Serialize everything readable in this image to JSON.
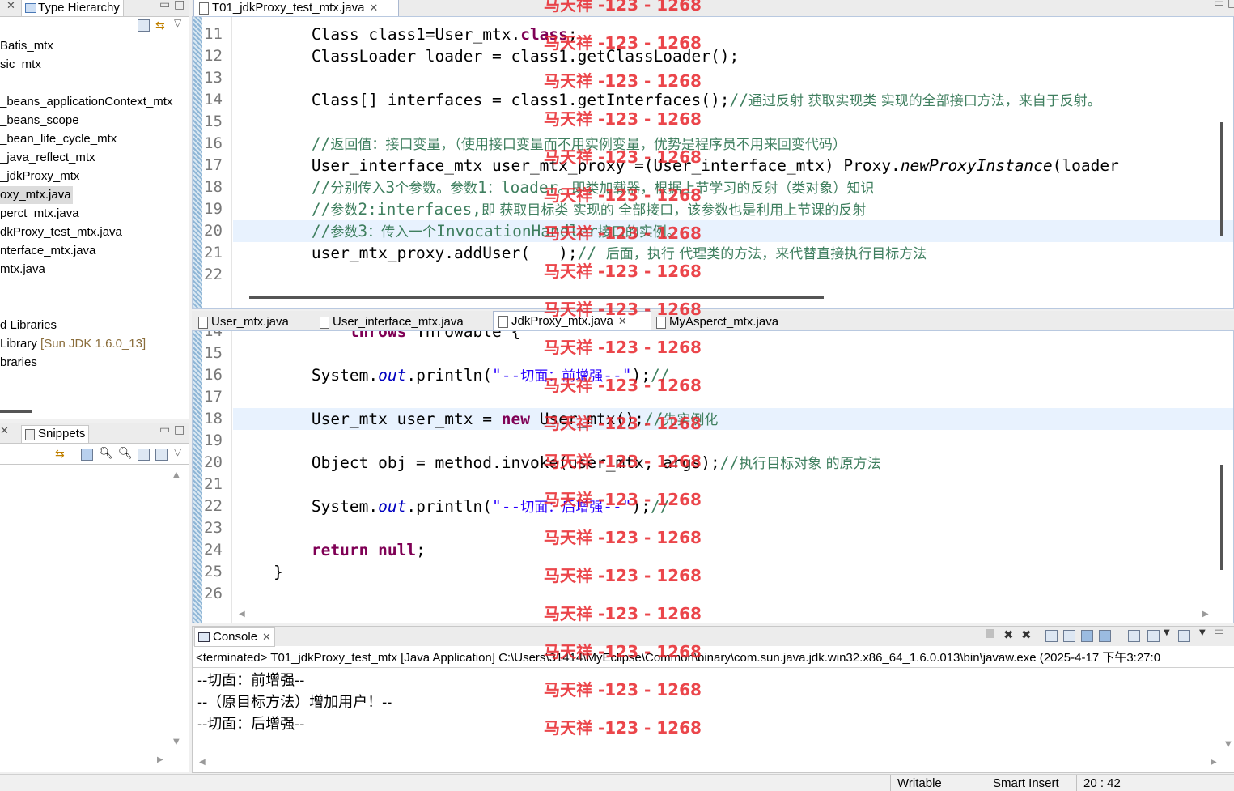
{
  "left_panel": {
    "tab_title": "Type Hierarchy",
    "tree_items": [
      "Batis_mtx",
      "sic_mtx",
      "_beans_applicationContext_mtx",
      "_beans_scope",
      "_bean_life_cycle_mtx",
      "_java_reflect_mtx",
      "_jdkProxy_mtx",
      "oxy_mtx.java",
      "perct_mtx.java",
      "dkProxy_test_mtx.java",
      "nterface_mtx.java",
      "mtx.java",
      "d Libraries",
      " Library",
      "braries"
    ],
    "library_suffix": "[Sun JDK 1.6.0_13]",
    "snippets_tab": "Snippets"
  },
  "editor_top": {
    "tab": "T01_jdkProxy_test_mtx.java",
    "lines": [
      {
        "n": "11",
        "parts": [
          [
            "",
            "        Class class1=User_mtx."
          ],
          [
            "kw",
            "class"
          ],
          [
            "",
            ";"
          ]
        ]
      },
      {
        "n": "12",
        "parts": [
          [
            "",
            "        ClassLoader loader = class1.getClassLoader();"
          ]
        ]
      },
      {
        "n": "13",
        "parts": [
          [
            "",
            ""
          ]
        ]
      },
      {
        "n": "14",
        "parts": [
          [
            "",
            "        Class[] interfaces = class1.getInterfaces();"
          ],
          [
            "cm",
            "//"
          ],
          [
            "cm-cn",
            "通过反射 获取实现类 实现的全部接口方法，来自于反射。"
          ]
        ]
      },
      {
        "n": "15",
        "parts": [
          [
            "",
            ""
          ]
        ]
      },
      {
        "n": "16",
        "parts": [
          [
            "",
            "        "
          ],
          [
            "cm",
            "//"
          ],
          [
            "cm-cn",
            "返回值：接口变量，（使用接口变量而不用实例变量，优势是程序员不用来回变代码）"
          ]
        ]
      },
      {
        "n": "17",
        "parts": [
          [
            "",
            "        User_interface_mtx user_mtx_proxy =(User_interface_mtx) Proxy."
          ],
          [
            "it",
            "newProxyInstance"
          ],
          [
            "",
            "(loader"
          ]
        ]
      },
      {
        "n": "18",
        "parts": [
          [
            "",
            "        "
          ],
          [
            "cm",
            "//"
          ],
          [
            "cm-cn",
            "分别传入"
          ],
          [
            "cm",
            "3"
          ],
          [
            "cm-cn",
            "个参数。参数"
          ],
          [
            "cm",
            "1"
          ],
          [
            "cm-cn",
            "："
          ],
          [
            "cm",
            "loader"
          ],
          [
            "cm-cn",
            "。即类加载器，根据上节学习的反射（类对象）知识"
          ]
        ]
      },
      {
        "n": "19",
        "parts": [
          [
            "",
            "        "
          ],
          [
            "cm",
            "//"
          ],
          [
            "cm-cn",
            "参数"
          ],
          [
            "cm",
            "2:interfaces,"
          ],
          [
            "cm-cn",
            "即 获取目标类 实现的 全部接口，该参数也是利用上节课的反射"
          ]
        ]
      },
      {
        "n": "20",
        "parts": [
          [
            "",
            "        "
          ],
          [
            "cm",
            "//"
          ],
          [
            "cm-cn",
            "参数"
          ],
          [
            "cm",
            "3"
          ],
          [
            "cm-cn",
            "：传入一个"
          ],
          [
            "cm",
            "InvocationHandler"
          ],
          [
            "cm-cn",
            "接口的实例。"
          ]
        ]
      },
      {
        "n": "21",
        "parts": [
          [
            "",
            "        user_mtx_proxy.addUser(   );"
          ],
          [
            "cm",
            "// "
          ],
          [
            "cm-cn",
            "后面，执行 代理类的方法，来代替直接执行目标方法"
          ]
        ]
      },
      {
        "n": "22",
        "parts": [
          [
            "",
            ""
          ]
        ]
      }
    ]
  },
  "editor_bottom": {
    "tabs": [
      "User_mtx.java",
      "User_interface_mtx.java",
      "JdkProxy_mtx.java",
      "MyAsperct_mtx.java"
    ],
    "partial_line": {
      "n": "14",
      "parts": [
        [
          "kw",
          "            throws"
        ],
        [
          "",
          " Throwable {"
        ]
      ]
    },
    "lines": [
      {
        "n": "15",
        "parts": [
          [
            "",
            ""
          ]
        ]
      },
      {
        "n": "16",
        "parts": [
          [
            "",
            "        System."
          ],
          [
            "fld",
            "out"
          ],
          [
            "",
            ".println("
          ],
          [
            "str",
            "\"--"
          ],
          [
            "str-cn",
            "切面：前增强"
          ],
          [
            "str",
            "--\""
          ],
          [
            "",
            ");"
          ],
          [
            "cm",
            "//"
          ]
        ]
      },
      {
        "n": "17",
        "parts": [
          [
            "",
            ""
          ]
        ]
      },
      {
        "n": "18",
        "parts": [
          [
            "",
            "        User_mtx user_mtx = "
          ],
          [
            "kw",
            "new"
          ],
          [
            "",
            " User_mtx();"
          ],
          [
            "cm",
            "//"
          ],
          [
            "cm-cn",
            "先实例化"
          ]
        ]
      },
      {
        "n": "19",
        "parts": [
          [
            "",
            ""
          ]
        ]
      },
      {
        "n": "20",
        "parts": [
          [
            "",
            "        Object obj = method.invoke(user_mtx, args);"
          ],
          [
            "cm",
            "//"
          ],
          [
            "cm-cn",
            "执行目标对象 的原方法"
          ]
        ]
      },
      {
        "n": "21",
        "parts": [
          [
            "",
            ""
          ]
        ]
      },
      {
        "n": "22",
        "parts": [
          [
            "",
            "        System."
          ],
          [
            "fld",
            "out"
          ],
          [
            "",
            ".println("
          ],
          [
            "str",
            "\"--"
          ],
          [
            "str-cn",
            "切面：后增强"
          ],
          [
            "str",
            "--\""
          ],
          [
            "",
            ");"
          ],
          [
            "cm",
            "//"
          ]
        ]
      },
      {
        "n": "23",
        "parts": [
          [
            "",
            ""
          ]
        ]
      },
      {
        "n": "24",
        "parts": [
          [
            "",
            "        "
          ],
          [
            "kw",
            "return null"
          ],
          [
            "",
            ";"
          ]
        ]
      },
      {
        "n": "25",
        "parts": [
          [
            "",
            "    }"
          ]
        ]
      },
      {
        "n": "26",
        "parts": [
          [
            "",
            ""
          ]
        ]
      }
    ]
  },
  "console": {
    "tab": "Console",
    "header": "<terminated> T01_jdkProxy_test_mtx [Java Application] C:\\Users\\31414\\MyEclipse\\Common\\binary\\com.sun.java.jdk.win32.x86_64_1.6.0.013\\bin\\javaw.exe (2025-4-17 下午3:27:0",
    "output": [
      "--切面：前增强--",
      "--（原目标方法）增加用户！--",
      "--切面：后增强--"
    ]
  },
  "watermark": "马天祥 -123 - 1268",
  "status_bar": {
    "writable": "Writable",
    "insert_mode": "Smart Insert",
    "position": "20 : 42"
  }
}
